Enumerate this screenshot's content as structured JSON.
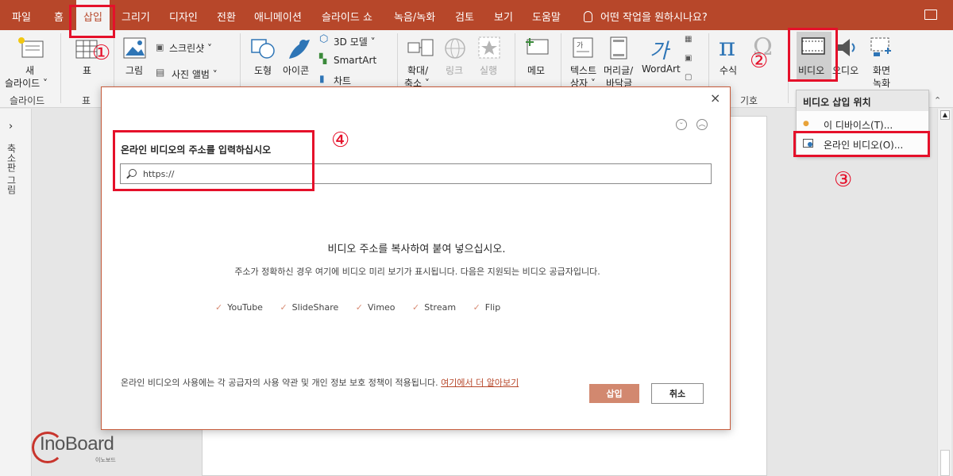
{
  "tabs": [
    "파일",
    "홈",
    "삽입",
    "그리기",
    "디자인",
    "전환",
    "애니메이션",
    "슬라이드 쇼",
    "녹음/녹화",
    "검토",
    "보기",
    "도움말"
  ],
  "tell_me": "어떤 작업을 원하시나요?",
  "ribbon": {
    "new_slide_1": "새",
    "new_slide_2": "슬라이드 ˅",
    "group_slides": "슬라이드",
    "table": "표",
    "group_table": "표",
    "picture": "그림",
    "screenshot": "스크린샷 ˅",
    "photo_album": "사진 앨범 ˅",
    "shapes": "도형",
    "icons": "아이콘",
    "model3d": "3D 모델 ˅",
    "smartart": "SmartArt",
    "chart": "차트",
    "zoom_1": "확대/",
    "zoom_2": "축소 ˅",
    "link": "링크",
    "action": "실행",
    "comment": "메모",
    "textbox_1": "텍스트",
    "textbox_2": "상자 ˅",
    "header_1": "머리글/",
    "header_2": "바닥글",
    "wordart": "WordArt",
    "equation": "수식",
    "group_symbols": "기호",
    "video": "비디오",
    "audio": "오디오",
    "screen_rec_1": "화면",
    "screen_rec_2": "녹화"
  },
  "left_pane_label": "축소판 그림",
  "dialog": {
    "title": "온라인 비디오의 주소를 입력하십시오",
    "placeholder": "https://",
    "heading": "비디오 주소를 복사하여 붙여 넣으십시오.",
    "description": "주소가 정확하신 경우 여기에 비디오 미리 보기가 표시됩니다. 다음은 지원되는 비디오 공급자입니다.",
    "providers": [
      "YouTube",
      "SlideShare",
      "Vimeo",
      "Stream",
      "Flip"
    ],
    "footer": "온라인 비디오의 사용에는 각 공급자의 사용 약관 및 개인 정보 보호 정책이 적용됩니다.",
    "footer_link": "여기에서 더 알아보기",
    "insert": "삽입",
    "cancel": "취소"
  },
  "menu": {
    "header": "비디오 삽입 위치",
    "item_device": "이 디바이스(T)...",
    "item_online": "온라인 비디오(O)..."
  },
  "annotations": [
    "①",
    "②",
    "③",
    "④"
  ],
  "logo": {
    "name": "InoBoard",
    "sub": "이노보드"
  },
  "colors": {
    "accent": "#b7472a",
    "highlight": "#e5102a",
    "insert_button": "#d2886f"
  }
}
